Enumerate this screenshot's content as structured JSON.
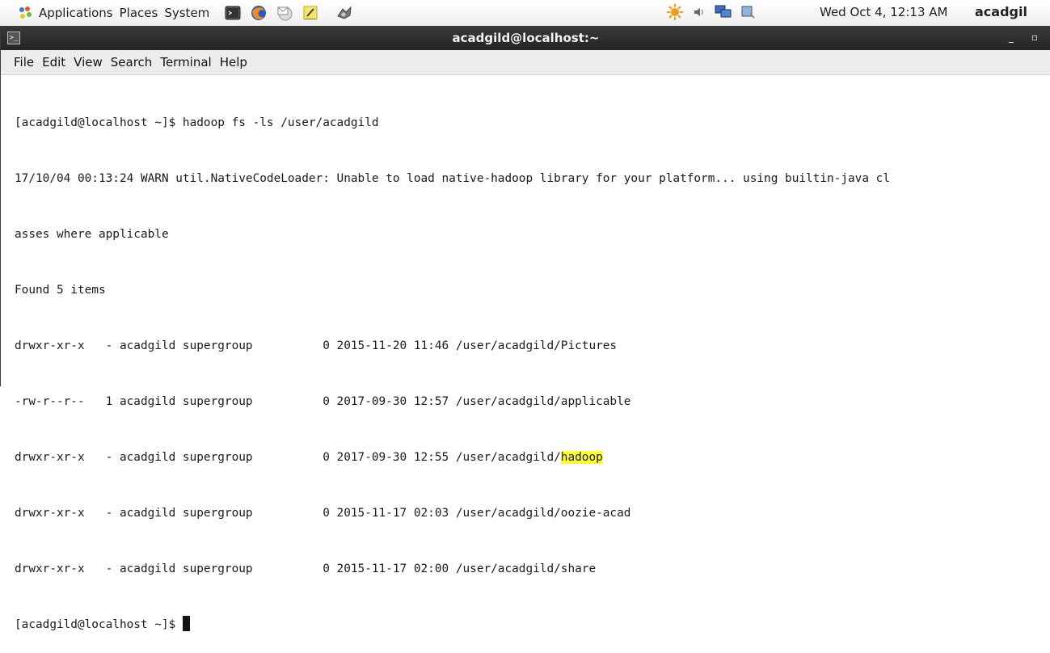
{
  "topbar": {
    "menus": [
      "Applications",
      "Places",
      "System"
    ],
    "clock": "Wed Oct  4, 12:13 AM",
    "user": "acadgil"
  },
  "window": {
    "title": "acadgild@localhost:~",
    "minimize": "_",
    "maximize": "▫",
    "menus": [
      "File",
      "Edit",
      "View",
      "Search",
      "Terminal",
      "Help"
    ]
  },
  "terminal": {
    "lines": [
      "[acadgild@localhost ~]$ hadoop fs -ls /user/acadgild",
      "17/10/04 00:13:24 WARN util.NativeCodeLoader: Unable to load native-hadoop library for your platform... using builtin-java cl",
      "asses where applicable",
      "Found 5 items",
      "drwxr-xr-x   - acadgild supergroup          0 2015-11-20 11:46 /user/acadgild/Pictures",
      "-rw-r--r--   1 acadgild supergroup          0 2017-09-30 12:57 /user/acadgild/applicable",
      "drwxr-xr-x   - acadgild supergroup          0 2017-09-30 12:55 /user/acadgild/",
      "drwxr-xr-x   - acadgild supergroup          0 2015-11-17 02:03 /user/acadgild/oozie-acad",
      "drwxr-xr-x   - acadgild supergroup          0 2015-11-17 02:00 /user/acadgild/share",
      "[acadgild@localhost ~]$ "
    ],
    "highlight": "hadoop",
    "colors": {
      "highlight": "#ffff33",
      "text": "#1a1a1a"
    }
  }
}
